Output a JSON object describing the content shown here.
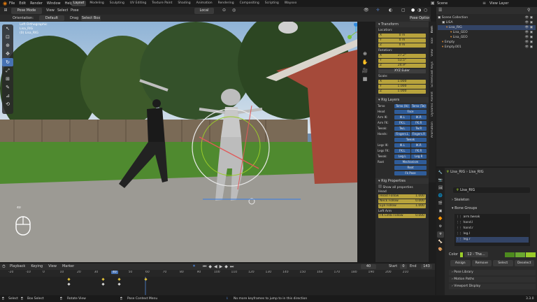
{
  "menus": [
    "File",
    "Edit",
    "Render",
    "Window",
    "Help"
  ],
  "workspace_tabs": [
    "Layout",
    "Modeling",
    "Sculpting",
    "UV Editing",
    "Texture Paint",
    "Shading",
    "Animation",
    "Rendering",
    "Compositing",
    "Scripting",
    "Wayxxx"
  ],
  "scene": {
    "label": "Scene",
    "view_layer": "View Layer"
  },
  "header": {
    "mode": "Pose Mode",
    "view": "View",
    "select": "Select",
    "pose": "Pose",
    "transform": "Local",
    "orientation": "Default",
    "orient_label": "Orientation:",
    "drag": "Drag",
    "select_box": "Select Box",
    "pose_options": "Pose Options"
  },
  "viewport": {
    "overlay_lines": [
      "Left Orthographic",
      "Lisa_RIG",
      "(0) Lisa_RIG"
    ],
    "frame_label": "40"
  },
  "n_panel": {
    "tabs": [
      "Item",
      "Tool",
      "View",
      "Screencast Keys",
      "Dynamic Parent",
      "Animation"
    ],
    "transform_title": "Transform",
    "location_label": "Location:",
    "location": [
      "0 m",
      "0 m",
      "0 m"
    ],
    "rotation_label": "Rotation:",
    "rotation": [
      "27.2°",
      "53.5°",
      "24.9°"
    ],
    "rotation_mode": "XYZ Euler",
    "scale_label": "Scale:",
    "scale": [
      "1.000",
      "1.000",
      "1.000"
    ],
    "axes": [
      "X",
      "Y",
      "Z"
    ],
    "rig_layers_title": "Rig Layers",
    "rig_layers": [
      {
        "label": "Torso",
        "buttons": [
          "Torso (Ik)",
          "Torso (Tw)"
        ]
      },
      {
        "label": "Head",
        "buttons": [
          "Face"
        ]
      },
      {
        "label": "Arm IK:",
        "buttons": [
          "IK.L",
          "IK.R"
        ]
      },
      {
        "label": "Arm FK:",
        "buttons": [
          "FK.L",
          "FK.R"
        ]
      },
      {
        "label": "Tweak:",
        "buttons": [
          "Tw.L",
          "Tw.R"
        ]
      },
      {
        "label": "Hands:",
        "buttons": [
          "Fingers.L",
          "Fingers.R"
        ]
      },
      {
        "label": "",
        "buttons": [
          "Tweak"
        ]
      },
      {
        "label": "Legs IK:",
        "buttons": [
          "IK.L",
          "IK.R"
        ]
      },
      {
        "label": "Legs FK:",
        "buttons": [
          "FK.L",
          "FK.R"
        ]
      },
      {
        "label": "Tweak:",
        "buttons": [
          "Leg.L",
          "Leg.R"
        ]
      },
      {
        "label": "Root",
        "buttons": [
          "Mechanism"
        ]
      },
      {
        "label": "",
        "buttons": [
          "Root"
        ]
      },
      {
        "label": "",
        "buttons": [
          "Fk Pose"
        ]
      }
    ],
    "rig_props_title": "Rig Properties",
    "show_all": "Show all properties",
    "head_label": "Head",
    "head_props": [
      {
        "name": "Head Follow",
        "value": "1.000"
      },
      {
        "name": "Neck Follow",
        "value": "0.000"
      },
      {
        "name": "Eye Follow",
        "value": "1.000"
      }
    ],
    "left_arm_label": "Left Arm",
    "left_arm_props": [
      {
        "name": "FK Limb Follow",
        "value": "0.000"
      }
    ]
  },
  "outliner": {
    "title": "Scene Collection",
    "items": [
      "Scene Collection",
      "LISA",
      "Lisa_RIG",
      "Lisa_GEO",
      "Lisa_GEO",
      "Empty",
      "Empty.001"
    ]
  },
  "properties": {
    "object": "Lisa_RIG",
    "armature": "Lisa_RIG",
    "sections": [
      "Skeleton",
      "Bone Groups"
    ],
    "bone_groups": [
      "arm.tweak",
      "hand.l",
      "hand.r",
      "leg.l",
      "leg.r"
    ],
    "color_label": "Color",
    "color_value": "12 - The...",
    "group_buttons": [
      "Assign",
      "Remove",
      "Select",
      "Deselect"
    ],
    "bottom_sections": [
      "Pose Library",
      "Motion Paths",
      "Viewport Display"
    ]
  },
  "timeline": {
    "menus": [
      "Playback",
      "Keying",
      "View",
      "Marker"
    ],
    "current_frame": "40",
    "start_label": "Start",
    "start": "0",
    "end_label": "End",
    "end": "143",
    "ticks": [
      "-20",
      "-10",
      "0",
      "10",
      "20",
      "30",
      "40",
      "50",
      "60",
      "70",
      "80",
      "90",
      "100",
      "110",
      "120",
      "130",
      "140",
      "150",
      "160",
      "170",
      "180",
      "190",
      "200",
      "210"
    ]
  },
  "status_bar": {
    "items": [
      "Select",
      "Box Select",
      "Rotate View",
      "Pose Context Menu"
    ],
    "message": "No more keyframes to jump to in this direction",
    "version": "3.3.0"
  },
  "colors": {
    "accent": "#4772b3",
    "yellow": "#b8a33c",
    "bg": "#1d1d1d"
  }
}
